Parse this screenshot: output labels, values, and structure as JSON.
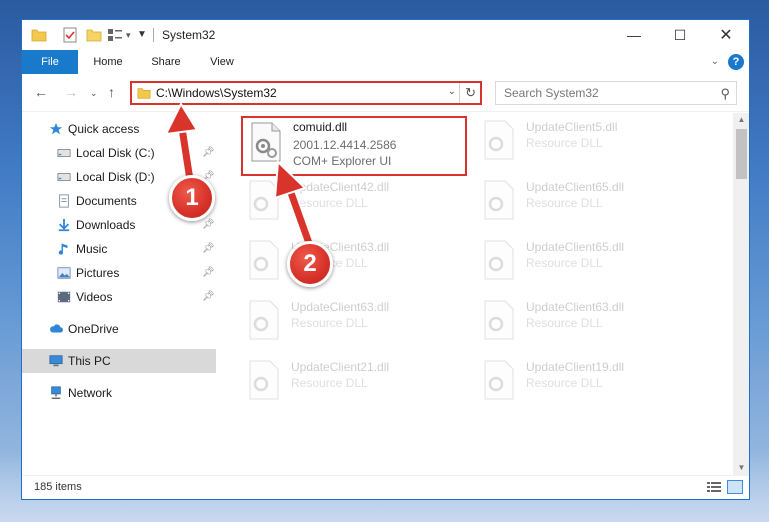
{
  "window": {
    "title": "System32",
    "controls": {
      "minimize": "—",
      "maximize": "☐",
      "close": "✕"
    }
  },
  "ribbon": {
    "tabs": [
      "File",
      "Home",
      "Share",
      "View"
    ],
    "help": "?"
  },
  "address_bar": {
    "path": "C:\\Windows\\System32",
    "search_placeholder": "Search System32"
  },
  "sidebar": {
    "items": [
      {
        "label": "Quick access",
        "icon": "star-icon",
        "pinned": false
      },
      {
        "label": "Local Disk (C:)",
        "icon": "drive-icon",
        "pinned": true
      },
      {
        "label": "Local Disk (D:)",
        "icon": "drive-icon",
        "pinned": true
      },
      {
        "label": "Documents",
        "icon": "documents-icon",
        "pinned": true
      },
      {
        "label": "Downloads",
        "icon": "download-icon",
        "pinned": true
      },
      {
        "label": "Music",
        "icon": "music-icon",
        "pinned": true
      },
      {
        "label": "Pictures",
        "icon": "pictures-icon",
        "pinned": true
      },
      {
        "label": "Videos",
        "icon": "videos-icon",
        "pinned": true
      },
      {
        "label": "OneDrive",
        "icon": "cloud-icon",
        "pinned": false
      },
      {
        "label": "This PC",
        "icon": "computer-icon",
        "pinned": false,
        "selected": true
      },
      {
        "label": "Network",
        "icon": "network-icon",
        "pinned": false
      }
    ]
  },
  "files": [
    {
      "name": "comuid.dll",
      "version": "2001.12.4414.2586",
      "description": "COM+ Explorer UI",
      "highlighted": true
    },
    {
      "name": "UpdateClient5.dll",
      "version": "",
      "description": "Resource DLL",
      "faded": true
    },
    {
      "name": "UpdateClient42.dll",
      "version": "",
      "description": "Resource DLL",
      "faded": true
    },
    {
      "name": "UpdateClient65.dll",
      "version": "",
      "description": "Resource DLL",
      "faded": true
    },
    {
      "name": "UpdateClient63.dll",
      "version": "",
      "description": "Resource DLL",
      "faded": true
    },
    {
      "name": "UpdateClient65.dll",
      "version": "",
      "description": "Resource DLL",
      "faded": true
    },
    {
      "name": "UpdateClient63.dll",
      "version": "",
      "description": "Resource DLL",
      "faded": true
    },
    {
      "name": "UpdateClient63.dll",
      "version": "",
      "description": "Resource DLL",
      "faded": true
    },
    {
      "name": "UpdateClient21.dll",
      "version": "",
      "description": "Resource DLL",
      "faded": true
    },
    {
      "name": "UpdateClient19.dll",
      "version": "",
      "description": "Resource DLL",
      "faded": true
    }
  ],
  "status": {
    "item_count": "185 items"
  },
  "annotations": {
    "step1": "1",
    "step2": "2",
    "color": "#d9342b"
  },
  "colors": {
    "accent": "#1979ca",
    "highlight": "#d9342b",
    "selected_bg": "#d9d9d9"
  }
}
